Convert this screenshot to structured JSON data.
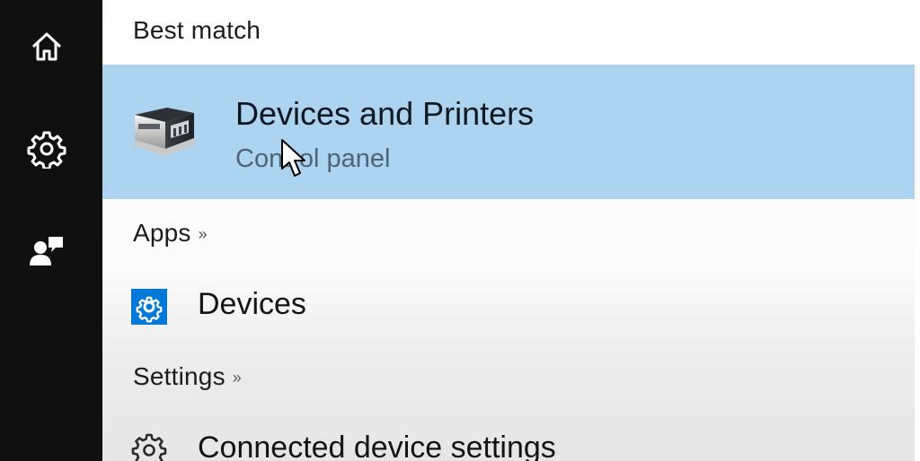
{
  "rail": {
    "items": [
      {
        "icon": "home-icon"
      },
      {
        "icon": "gear-icon"
      },
      {
        "icon": "feedback-icon"
      }
    ]
  },
  "best_match": {
    "header": "Best match",
    "title_bold": "Devices",
    "title_rest": " and Printers",
    "subtitle": "Control panel",
    "icon": "printer-icon",
    "highlight_color": "#acd3f0"
  },
  "apps": {
    "header": "Apps",
    "chevron": "»",
    "items": [
      {
        "label": "Devices",
        "icon": "settings-gear-blue-icon",
        "accent": "#0078d7"
      }
    ]
  },
  "settings": {
    "header": "Settings",
    "chevron": "»",
    "items": [
      {
        "label": "Connected device settings",
        "icon": "gear-outline-icon"
      }
    ]
  }
}
